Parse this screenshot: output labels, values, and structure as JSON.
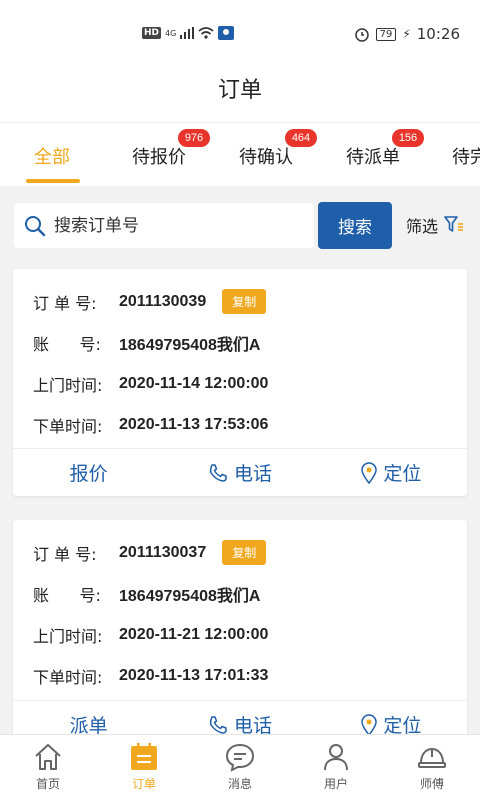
{
  "status": {
    "hd": "HD",
    "net": "4G",
    "battery": "79",
    "time": "10:26"
  },
  "header": {
    "title": "订单"
  },
  "tabs": [
    {
      "label": "全部",
      "badge": ""
    },
    {
      "label": "待报价",
      "badge": "976"
    },
    {
      "label": "待确认",
      "badge": "464"
    },
    {
      "label": "待派单",
      "badge": "156"
    },
    {
      "label": "待完",
      "badge": ""
    }
  ],
  "search": {
    "placeholder": "搜索订单号",
    "button": "搜索",
    "filter_label": "筛选"
  },
  "orders": [
    {
      "order_no_label": "订 单 号:",
      "order_no": "2011130039",
      "copy_label": "复制",
      "account_label": "账      号:",
      "account": "18649795408我们A",
      "visit_label": "上门时间:",
      "visit_time": "2020-11-14 12:00:00",
      "placed_label": "下单时间:",
      "placed_time": "2020-11-13 17:53:06",
      "actions": [
        "报价",
        "电话",
        "定位"
      ]
    },
    {
      "order_no_label": "订 单 号:",
      "order_no": "2011130037",
      "copy_label": "复制",
      "account_label": "账      号:",
      "account": "18649795408我们A",
      "visit_label": "上门时间:",
      "visit_time": "2020-11-21 12:00:00",
      "placed_label": "下单时间:",
      "placed_time": "2020-11-13 17:01:33",
      "actions": [
        "派单",
        "电话",
        "定位"
      ]
    }
  ],
  "bottom_nav": [
    {
      "label": "首页",
      "icon": "home-icon"
    },
    {
      "label": "订单",
      "icon": "order-icon",
      "active": true
    },
    {
      "label": "消息",
      "icon": "message-icon"
    },
    {
      "label": "用户",
      "icon": "user-icon"
    },
    {
      "label": "师傅",
      "icon": "worker-helmet-icon"
    }
  ],
  "colors": {
    "accent": "#f0a81e",
    "primary": "#1f5ea8",
    "badge": "#e8342a"
  }
}
